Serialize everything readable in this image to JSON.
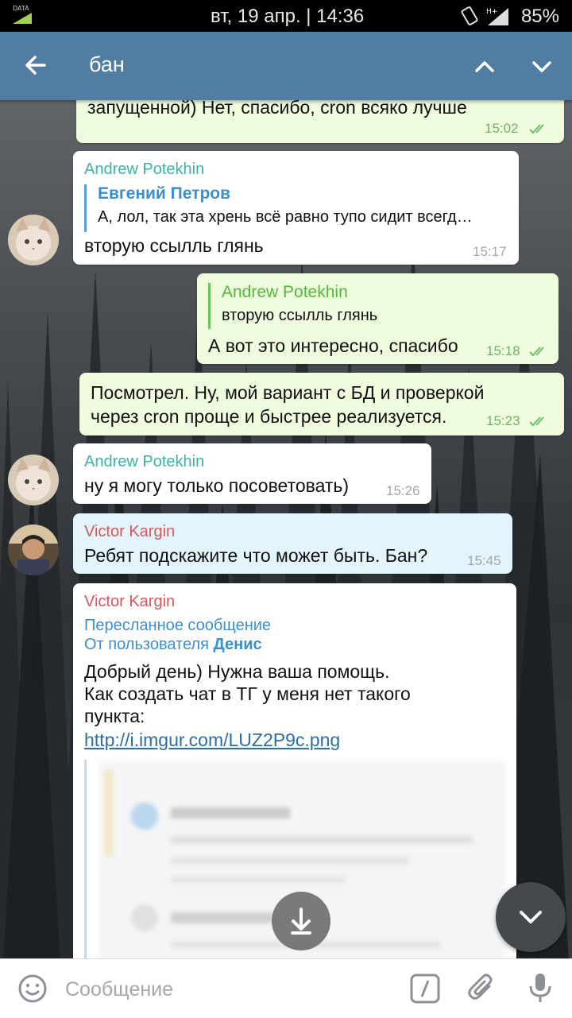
{
  "status_bar": {
    "data_label": "DATA",
    "date_time": "вт, 19 апр. | 14:36",
    "battery": "85%"
  },
  "header": {
    "search_query": "бан"
  },
  "messages": [
    {
      "text": "запущенной) Нет, спасибо, cron всяко лучше",
      "time": "15:02"
    },
    {
      "sender": "Andrew Potekhin",
      "reply_to": "Евгений Петров",
      "reply_text": "А, лол, так эта хрень всё равно тупо сидит всегд…",
      "text": "вторую ссылль глянь",
      "time": "15:17"
    },
    {
      "reply_to": "Andrew Potekhin",
      "reply_text": "вторую ссылль глянь",
      "text": "А вот это интересно, спасибо",
      "time": "15:18"
    },
    {
      "line1": "Посмотрел. Ну, мой вариант с БД и проверкой",
      "line2": "через cron проще и быстрее реализуется.",
      "time": "15:23"
    },
    {
      "sender": "Andrew Potekhin",
      "text": "ну я могу только посоветовать)",
      "time": "15:26"
    },
    {
      "sender": "Victor Kargin",
      "text": "Ребят подскажите что может быть. Бан?",
      "time": "15:45"
    },
    {
      "sender": "Victor Kargin",
      "forwarded": "Пересланное сообщение",
      "from_prefix": "От пользователя",
      "from_user": "Денис",
      "line1": "Добрый день) Нужна ваша помощь.",
      "line2": "Как создать чат в ТГ у меня нет такого",
      "line3": "пункта:",
      "link": "http://i.imgur.com/LUZ2P9c.png"
    }
  ],
  "composer": {
    "placeholder": "Сообщение"
  },
  "colors": {
    "appbar": "#517da2",
    "incoming": "#ffffff",
    "outgoing": "#effdde",
    "highlighted": "#e3f4fb"
  }
}
